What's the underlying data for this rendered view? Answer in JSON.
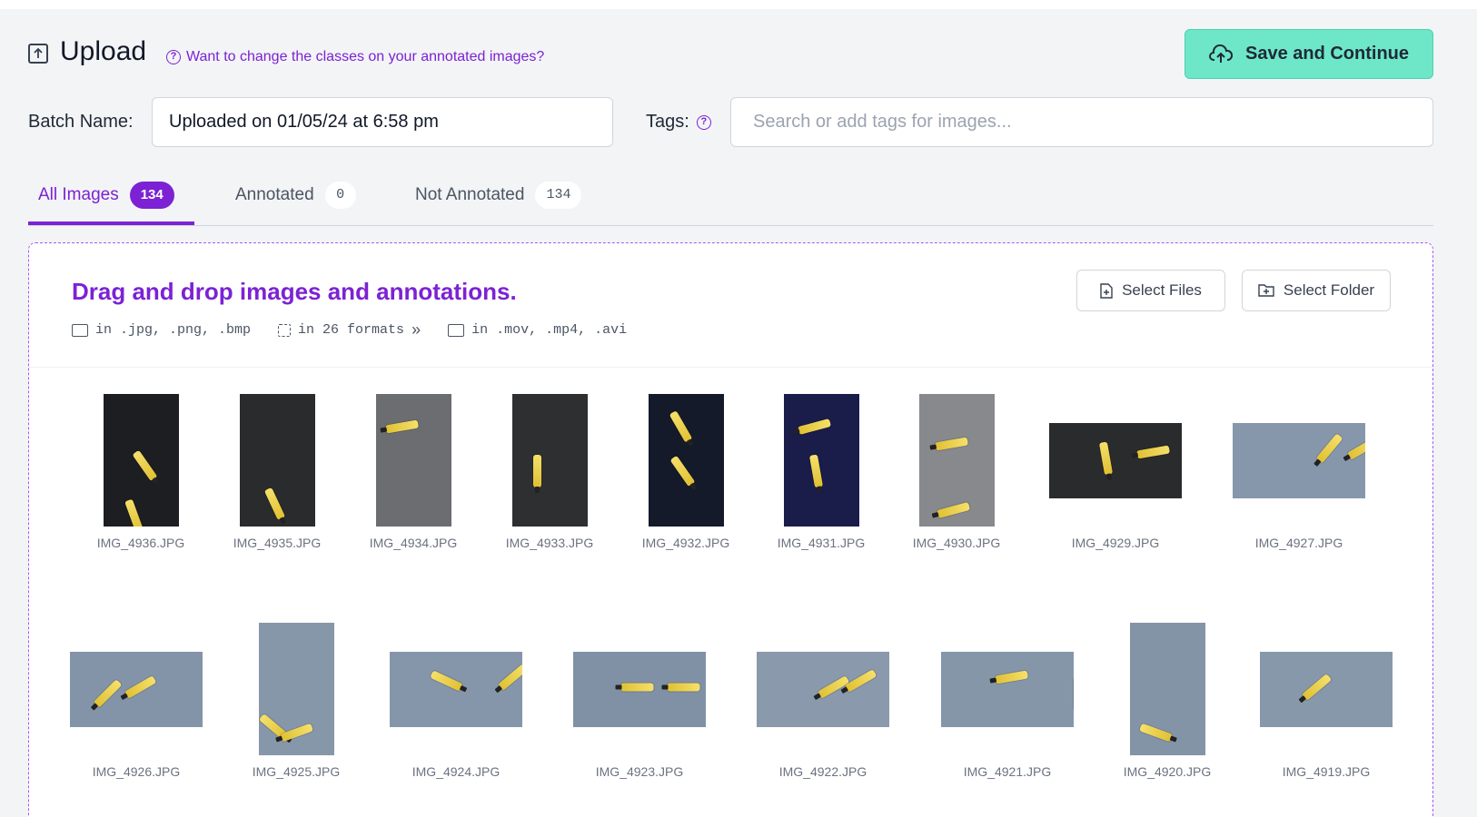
{
  "header": {
    "title": "Upload",
    "help_link": "Want to change the classes on your annotated images?",
    "save_button": "Save and Continue"
  },
  "batch": {
    "label": "Batch Name:",
    "value": "Uploaded on 01/05/24 at 6:58 pm"
  },
  "tags": {
    "label": "Tags:",
    "placeholder": "Search or add tags for images..."
  },
  "tabs": [
    {
      "label": "All Images",
      "count": "134",
      "active": true
    },
    {
      "label": "Annotated",
      "count": "0",
      "active": false
    },
    {
      "label": "Not Annotated",
      "count": "134",
      "active": false
    }
  ],
  "dropzone": {
    "title": "Drag and drop images and annotations.",
    "image_formats": "in .jpg, .png, .bmp",
    "annotation_formats": "in 26 formats",
    "more": "»",
    "video_formats": "in .mov, .mp4, .avi",
    "select_files": "Select Files",
    "select_folder": "Select Folder"
  },
  "images": [
    {
      "name": "IMG_4936.JPG",
      "bg": "#1c1e22"
    },
    {
      "name": "IMG_4935.JPG",
      "bg": "#2a2b2d"
    },
    {
      "name": "IMG_4934.JPG",
      "bg": "#6b6d70"
    },
    {
      "name": "IMG_4933.JPG",
      "bg": "#2e2f31"
    },
    {
      "name": "IMG_4932.JPG",
      "bg": "#141a2a"
    },
    {
      "name": "IMG_4931.JPG",
      "bg": "#1a1c4a"
    },
    {
      "name": "IMG_4930.JPG",
      "bg": "#87898c"
    },
    {
      "name": "IMG_4929.JPG",
      "bg": "#2a2b2c"
    },
    {
      "name": "IMG_4927.JPG",
      "bg": "#8797ab"
    },
    {
      "name": "IMG_4926.JPG",
      "bg": "#8494a8"
    },
    {
      "name": "IMG_4925.JPG",
      "bg": "#8797aa"
    },
    {
      "name": "IMG_4924.JPG",
      "bg": "#8696aa"
    },
    {
      "name": "IMG_4923.JPG",
      "bg": "#8191a5"
    },
    {
      "name": "IMG_4922.JPG",
      "bg": "#8a99ac"
    },
    {
      "name": "IMG_4921.JPG",
      "bg": "#8696a9"
    },
    {
      "name": "IMG_4920.JPG",
      "bg": "#8494a7"
    },
    {
      "name": "IMG_4919.JPG",
      "bg": "#8898ab"
    }
  ],
  "colors": {
    "accent": "#7c22d4",
    "save_button": "#6ee7c8",
    "background": "#f3f4f6"
  }
}
